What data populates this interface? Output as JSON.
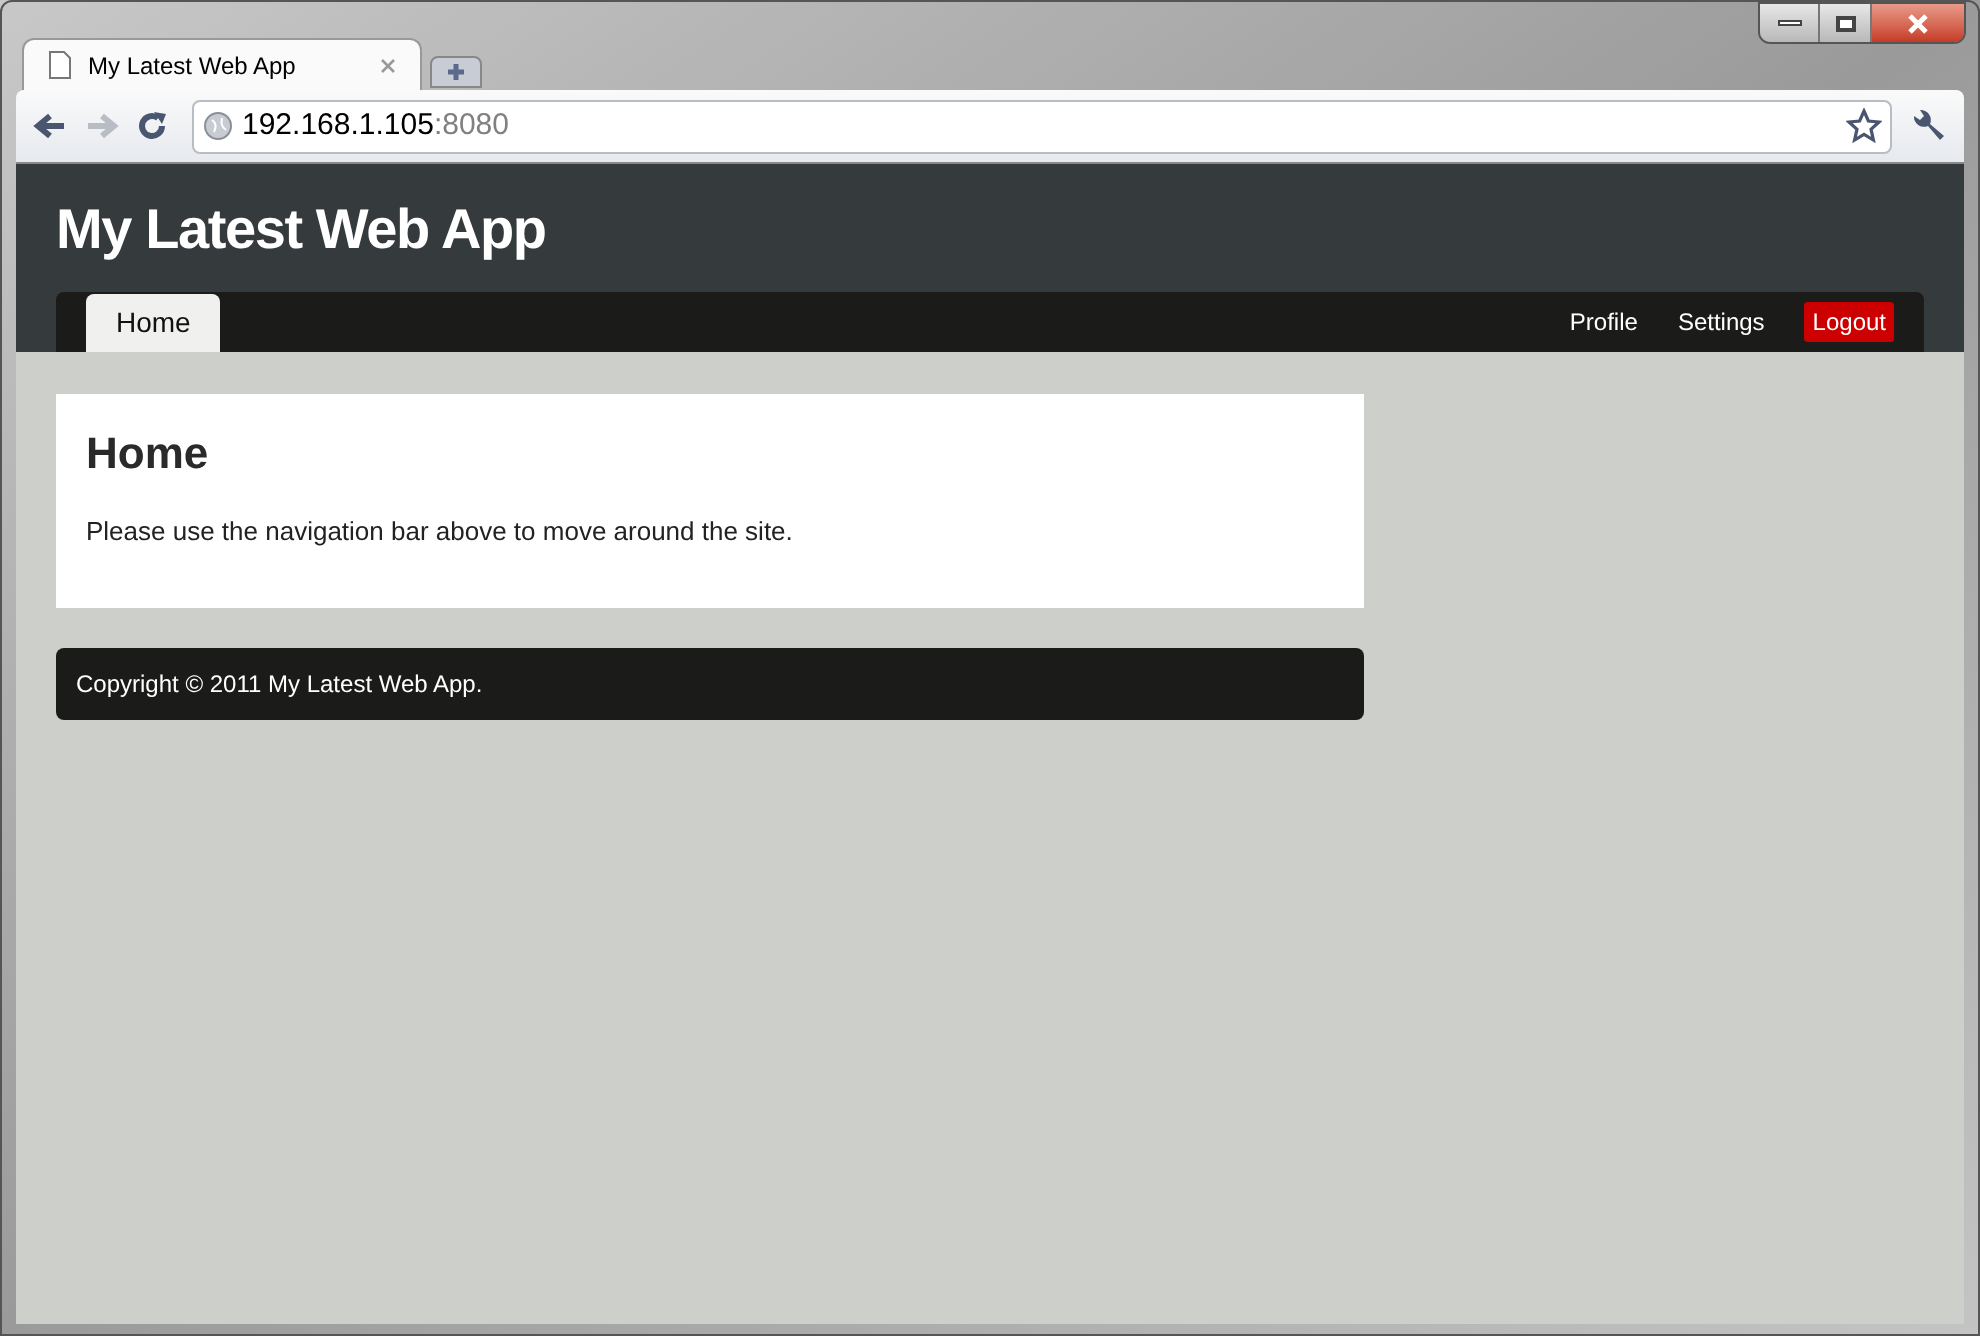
{
  "browser": {
    "tabs": [
      {
        "title": "My Latest Web App",
        "selected": true
      }
    ],
    "address": {
      "host": "192.168.1.105",
      "port": ":8080"
    }
  },
  "page": {
    "site_title": "My Latest Web App",
    "nav_left": [
      {
        "label": "Home",
        "selected": true
      }
    ],
    "nav_right": [
      {
        "label": "Profile",
        "kind": "link"
      },
      {
        "label": "Settings",
        "kind": "link"
      },
      {
        "label": "Logout",
        "kind": "danger"
      }
    ],
    "content": {
      "heading": "Home",
      "text": "Please use the navigation bar above to move around the site."
    },
    "footer": "Copyright © 2011 My Latest Web App."
  }
}
